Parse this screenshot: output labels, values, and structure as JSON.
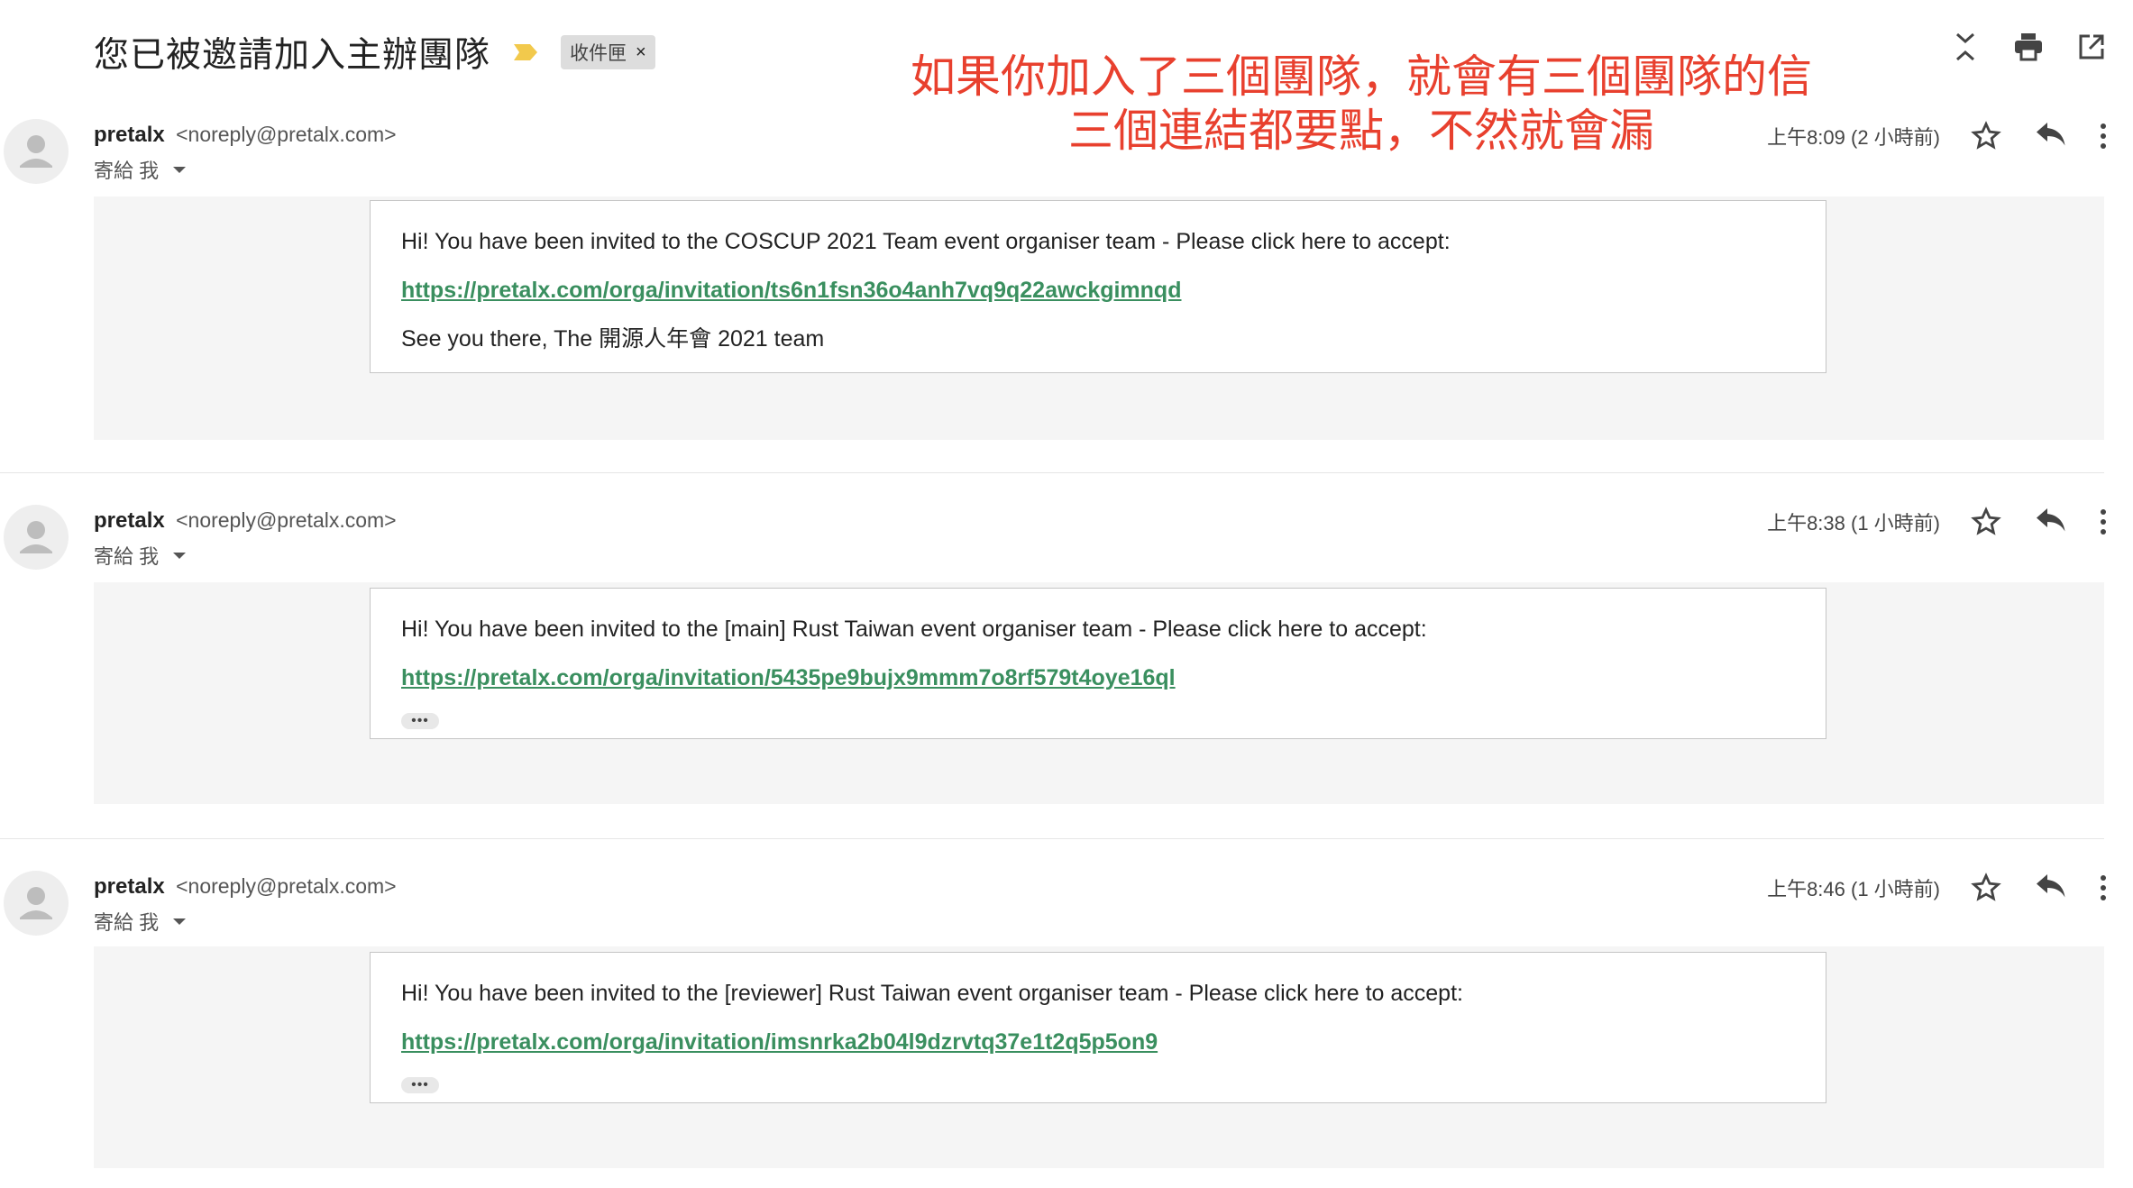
{
  "subject": "您已被邀請加入主辦團隊",
  "label_chip": "收件匣",
  "label_close": "×",
  "importance_color": "#f2c94c",
  "annotation": {
    "line1": "如果你加入了三個團隊，就會有三個團隊的信",
    "line2": "三個連結都要點，不然就會漏",
    "color": "#e8402e"
  },
  "toolbar_icons": [
    "collapse-all-icon",
    "print-icon",
    "open-new-window-icon"
  ],
  "messages": [
    {
      "sender": "pretalx",
      "email": "<noreply@pretalx.com>",
      "to": "寄給 我",
      "time": "上午8:09 (2 小時前)",
      "body_line1": "Hi! You have been invited to the COSCUP 2021 Team event organiser team - Please click here to accept:",
      "link": "https://pretalx.com/orga/invitation/ts6n1fsn36o4anh7vq9q22awckgimnqd",
      "body_line3": "See you there, The 開源人年會 2021 team"
    },
    {
      "sender": "pretalx",
      "email": "<noreply@pretalx.com>",
      "to": "寄給 我",
      "time": "上午8:38 (1 小時前)",
      "body_line1": "Hi! You have been invited to the [main] Rust Taiwan event organiser team - Please click here to accept:",
      "link": "https://pretalx.com/orga/invitation/5435pe9bujx9mmm7o8rf579t4oye16ql",
      "ellipsis": "•••"
    },
    {
      "sender": "pretalx",
      "email": "<noreply@pretalx.com>",
      "to": "寄給 我",
      "time": "上午8:46 (1 小時前)",
      "body_line1": "Hi! You have been invited to the [reviewer] Rust Taiwan event organiser team - Please click here to accept:",
      "link": "https://pretalx.com/orga/invitation/imsnrka2b04l9dzrvtq37e1t2q5p5on9",
      "ellipsis": "•••"
    }
  ]
}
